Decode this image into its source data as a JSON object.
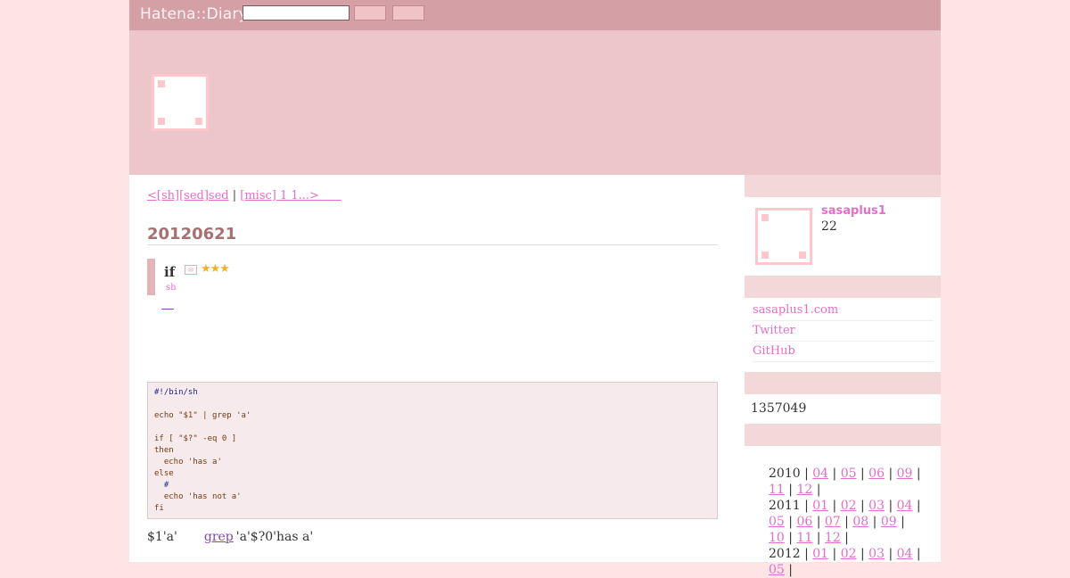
{
  "topbar": {
    "logo": "Hatena::Diary",
    "search_value": "",
    "button1_label": "",
    "button2_label": ""
  },
  "pager": {
    "prev_label": "<[sh][sed]sed",
    "separator": " | ",
    "next_label": "[misc] 1 1...>",
    "next_tail": "      "
  },
  "day": {
    "date": "20120621"
  },
  "entry": {
    "title": "if",
    "stars": "★★★",
    "category": "sh",
    "code_lines": [
      "#!/bin/sh",
      "",
      "echo \"$1\" | grep 'a'",
      "",
      "if [ \"$?\" -eq 0 ]",
      "then",
      "  echo 'has a'",
      "else",
      "  #",
      "  echo 'has not a'",
      "fi"
    ],
    "explanation_pre": "$1'a'",
    "explanation_link": "grep",
    "explanation_post": "'a'$?0'has a'"
  },
  "sidebar": {
    "profile_name": "sasaplus1",
    "profile_number": "22",
    "links": [
      "sasaplus1.com",
      "Twitter",
      "GitHub"
    ],
    "counter": "1357049",
    "archive": [
      {
        "year": "2010",
        "months": [
          "04",
          "05",
          "06",
          "09",
          "11",
          "12"
        ]
      },
      {
        "year": "2011",
        "months": [
          "01",
          "02",
          "03",
          "04",
          "05",
          "06",
          "07",
          "08",
          "09",
          "10",
          "11",
          "12"
        ]
      },
      {
        "year": "2012",
        "months": [
          "01",
          "02",
          "03",
          "04",
          "05"
        ]
      }
    ]
  },
  "colors": {
    "topbar": "#d4a0a5",
    "header": "#ecc6c8",
    "accent": "#e070c8",
    "background": "#ffe4e6"
  }
}
